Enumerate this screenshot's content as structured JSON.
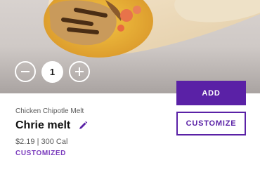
{
  "item": {
    "quantity": "1",
    "product_name": "Chicken Chipotle Melt",
    "custom_name": "Chrie melt",
    "price_calories": "$2.19 | 300 Cal",
    "status": "CUSTOMIZED"
  },
  "actions": {
    "add_label": "ADD",
    "customize_label": "CUSTOMIZE"
  },
  "icons": {
    "decrement": "minus-circle-icon",
    "increment": "plus-circle-icon",
    "edit": "pencil-icon"
  },
  "colors": {
    "accent": "#5a21a6",
    "status": "#7a3bbd"
  }
}
